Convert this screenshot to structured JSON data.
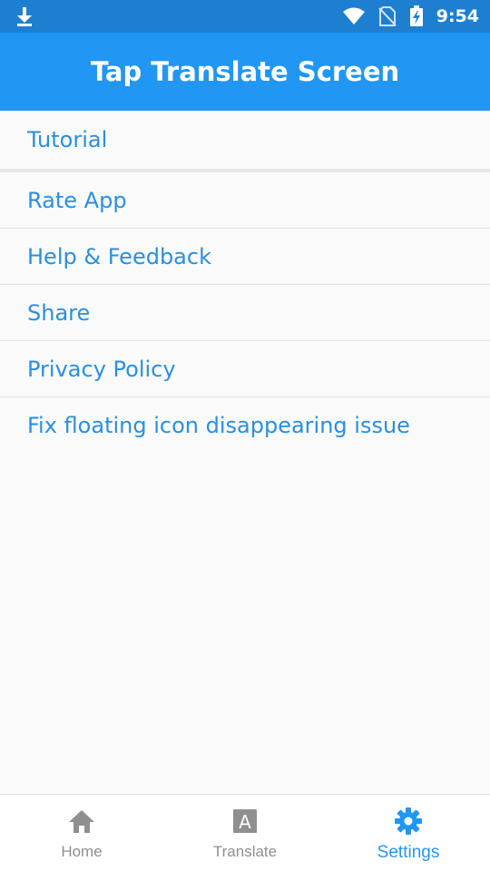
{
  "status_bar": {
    "time": "9:54",
    "icons": [
      "download-icon",
      "wifi-icon",
      "no-sim-icon",
      "battery-charging-icon"
    ]
  },
  "app_bar": {
    "title": "Tap Translate Screen"
  },
  "settings": {
    "items": [
      {
        "label": "Tutorial"
      },
      {
        "label": "Rate App"
      },
      {
        "label": "Help & Feedback"
      },
      {
        "label": "Share"
      },
      {
        "label": "Privacy Policy"
      },
      {
        "label": "Fix floating icon disappearing issue"
      }
    ]
  },
  "bottom_nav": {
    "items": [
      {
        "label": "Home",
        "icon": "home-icon",
        "active": false
      },
      {
        "label": "Translate",
        "icon": "translate-icon",
        "active": false
      },
      {
        "label": "Settings",
        "icon": "gear-icon",
        "active": true
      }
    ]
  },
  "colors": {
    "status_bar": "#1e7fd0",
    "app_bar": "#2196f3",
    "link_text": "#2a8fe0",
    "nav_inactive": "#8f8f8f",
    "nav_active": "#2196f3",
    "background": "#fafafa"
  }
}
